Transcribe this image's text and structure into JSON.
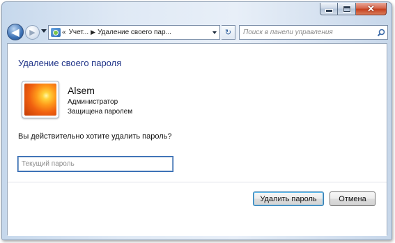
{
  "window": {
    "caption_buttons": {
      "minimize_icon": "minimize-icon",
      "maximize_icon": "maximize-icon",
      "close_icon": "close-icon",
      "close_glyph": "✕"
    }
  },
  "navigation": {
    "back_glyph": "◀",
    "forward_glyph": "▶",
    "breadcrumb": {
      "prefix": "«",
      "items": [
        "Учет...",
        "Удаление своего пар..."
      ]
    },
    "refresh_glyph": "↻",
    "search_placeholder": "Поиск в панели управления"
  },
  "page": {
    "title": "Удаление своего пароля",
    "user": {
      "name": "Alsem",
      "role": "Администратор",
      "status": "Защищена паролем"
    },
    "question": "Вы действительно хотите удалить пароль?",
    "password_field": {
      "placeholder": "Текущий пароль",
      "value": ""
    }
  },
  "buttons": {
    "delete": "Удалить пароль",
    "cancel": "Отмена"
  },
  "colors": {
    "title_blue": "#1e3287",
    "focus_blue": "#2d67b3",
    "close_red": "#c6401f"
  }
}
